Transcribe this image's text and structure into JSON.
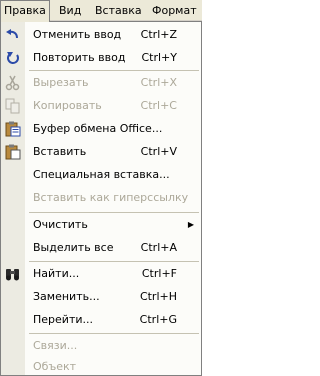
{
  "menubar": {
    "items": [
      {
        "label": "Правка"
      },
      {
        "label": "Вид"
      },
      {
        "label": "Вставка"
      },
      {
        "label": "Формат"
      }
    ]
  },
  "menu": {
    "items": [
      {
        "label": "Отменить ввод",
        "shortcut": "Ctrl+Z",
        "enabled": true,
        "icon": "undo-icon"
      },
      {
        "label": "Повторить ввод",
        "shortcut": "Ctrl+Y",
        "enabled": true,
        "icon": "redo-icon"
      },
      {
        "label": "Вырезать",
        "shortcut": "Ctrl+X",
        "enabled": false,
        "icon": "scissors-icon"
      },
      {
        "label": "Копировать",
        "shortcut": "Ctrl+C",
        "enabled": false,
        "icon": "copy-icon"
      },
      {
        "label": "Буфер обмена Office...",
        "shortcut": "",
        "enabled": true,
        "icon": "clipboard-icon"
      },
      {
        "label": "Вставить",
        "shortcut": "Ctrl+V",
        "enabled": true,
        "icon": "paste-icon"
      },
      {
        "label": "Специальная вставка...",
        "shortcut": "",
        "enabled": true
      },
      {
        "label": "Вставить как гиперссылку",
        "shortcut": "",
        "enabled": false
      },
      {
        "label": "Очистить",
        "shortcut": "",
        "enabled": true,
        "submenu": true
      },
      {
        "label": "Выделить все",
        "shortcut": "Ctrl+A",
        "enabled": true
      },
      {
        "label": "Найти...",
        "shortcut": "Ctrl+F",
        "enabled": true,
        "icon": "binoculars-icon"
      },
      {
        "label": "Заменить...",
        "shortcut": "Ctrl+H",
        "enabled": true
      },
      {
        "label": "Перейти...",
        "shortcut": "Ctrl+G",
        "enabled": true
      },
      {
        "label": "Связи...",
        "shortcut": "",
        "enabled": false
      },
      {
        "label": "Объект",
        "shortcut": "",
        "enabled": false
      }
    ]
  },
  "colors": {
    "menubar_bg": "#ece9d8",
    "menu_bg": "#fcfcf9",
    "gutter_bg": "#ecebe2",
    "disabled_text": "#aca899"
  }
}
